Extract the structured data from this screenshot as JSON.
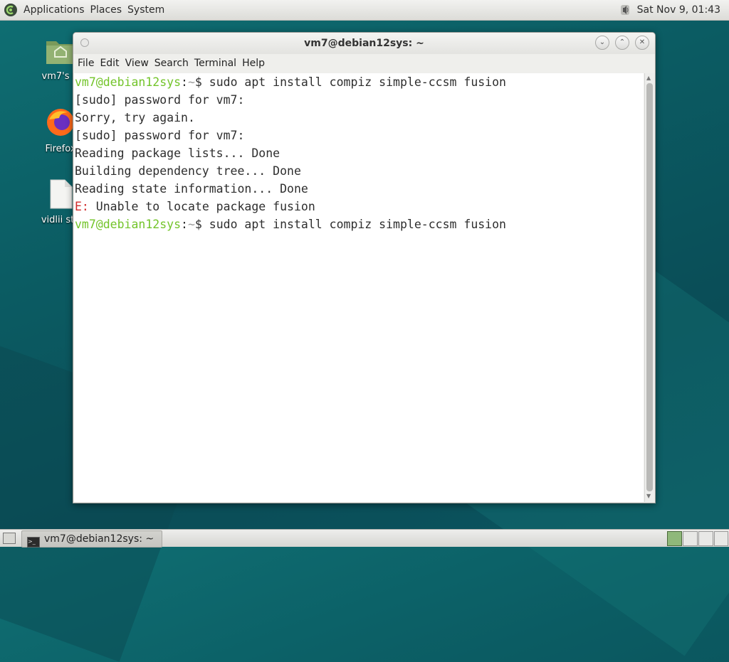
{
  "top_panel": {
    "menus": [
      "Applications",
      "Places",
      "System"
    ],
    "clock": "Sat Nov 9, 01:43"
  },
  "desktop": {
    "icons": [
      {
        "label": "vm7's H",
        "icon": "home-folder-icon"
      },
      {
        "label": "Firefox",
        "icon": "firefox-icon"
      },
      {
        "label": "vidlii sta",
        "icon": "file-icon"
      }
    ]
  },
  "window": {
    "title": "vm7@debian12sys: ~",
    "menu": [
      "File",
      "Edit",
      "View",
      "Search",
      "Terminal",
      "Help"
    ]
  },
  "terminal": {
    "prompt_user": "vm7@debian12sys",
    "prompt_sep": ":",
    "prompt_path": "~",
    "prompt_sym": "$ ",
    "cmd1": "sudo apt install compiz simple-ccsm fusion",
    "out1": "[sudo] password for vm7:",
    "out2": "Sorry, try again.",
    "out3": "[sudo] password for vm7:",
    "out4": "Reading package lists... Done",
    "out5": "Building dependency tree... Done",
    "out6": "Reading state information... Done",
    "err_prefix": "E:",
    "err_msg": " Unable to locate package fusion",
    "cmd2": "sudo apt install compiz simple-ccsm fusion"
  },
  "taskbar": {
    "task_label": "vm7@debian12sys: ~"
  },
  "colors": {
    "prompt_green": "#73c42a",
    "error_red": "#d02a2a"
  }
}
